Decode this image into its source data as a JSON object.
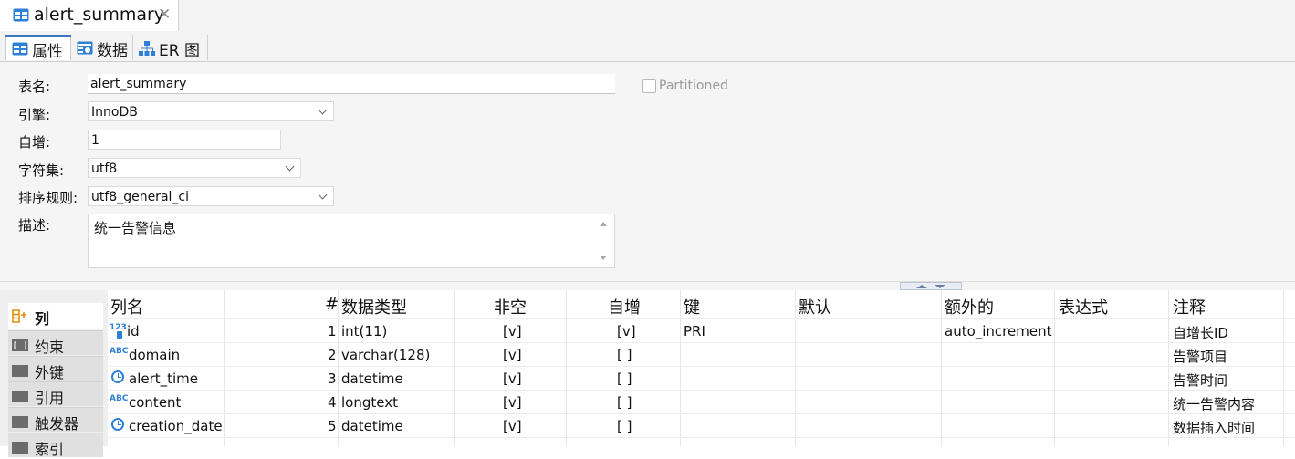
{
  "editor_tab": {
    "title": "alert_summary"
  },
  "sub_tabs": [
    {
      "label": "属性",
      "icon": "table-icon"
    },
    {
      "label": "数据",
      "icon": "data-grid-icon"
    },
    {
      "label": "ER 图",
      "icon": "er-diagram-icon"
    }
  ],
  "props": {
    "table_name_label": "表名:",
    "table_name": "alert_summary",
    "partitioned_label": "Partitioned",
    "partitioned": false,
    "engine_label": "引擎:",
    "engine": "InnoDB",
    "auto_inc_label": "自增:",
    "auto_inc": "1",
    "charset_label": "字符集:",
    "charset": "utf8",
    "collation_label": "排序规则:",
    "collation": "utf8_general_ci",
    "desc_label": "描述:",
    "description": "统一告警信息"
  },
  "sections": [
    {
      "label": "列"
    },
    {
      "label": "约束"
    },
    {
      "label": "外键"
    },
    {
      "label": "引用"
    },
    {
      "label": "触发器"
    },
    {
      "label": "索引"
    }
  ],
  "columns_header": [
    "列名",
    "#",
    "数据类型",
    "非空",
    "自增",
    "键",
    "默认",
    "额外的",
    "表达式",
    "注释"
  ],
  "rows": [
    {
      "name": "id",
      "type_icon": "number-icon",
      "num": "1",
      "data_type": "int(11)",
      "not_null": "[v]",
      "auto_inc": "[v]",
      "key": "PRI",
      "default": "",
      "extra": "auto_increment",
      "expr": "",
      "comment": "自增长ID"
    },
    {
      "name": "domain",
      "type_icon": "text-icon",
      "num": "2",
      "data_type": "varchar(128)",
      "not_null": "[v]",
      "auto_inc": "[ ]",
      "key": "",
      "default": "",
      "extra": "",
      "expr": "",
      "comment": "告警项目"
    },
    {
      "name": "alert_time",
      "type_icon": "clock-icon",
      "num": "3",
      "data_type": "datetime",
      "not_null": "[v]",
      "auto_inc": "[ ]",
      "key": "",
      "default": "",
      "extra": "",
      "expr": "",
      "comment": "告警时间"
    },
    {
      "name": "content",
      "type_icon": "text-icon",
      "num": "4",
      "data_type": "longtext",
      "not_null": "[v]",
      "auto_inc": "[ ]",
      "key": "",
      "default": "",
      "extra": "",
      "expr": "",
      "comment": "统一告警内容"
    },
    {
      "name": "creation_date",
      "type_icon": "clock-icon",
      "num": "5",
      "data_type": "datetime",
      "not_null": "[v]",
      "auto_inc": "[ ]",
      "key": "",
      "default": "",
      "extra": "",
      "expr": "",
      "comment": "数据插入时间"
    }
  ],
  "colors": {
    "accent": "#3a78c2",
    "icon_blue": "#2d7fd8",
    "section_key_orange": "#e08a00"
  }
}
